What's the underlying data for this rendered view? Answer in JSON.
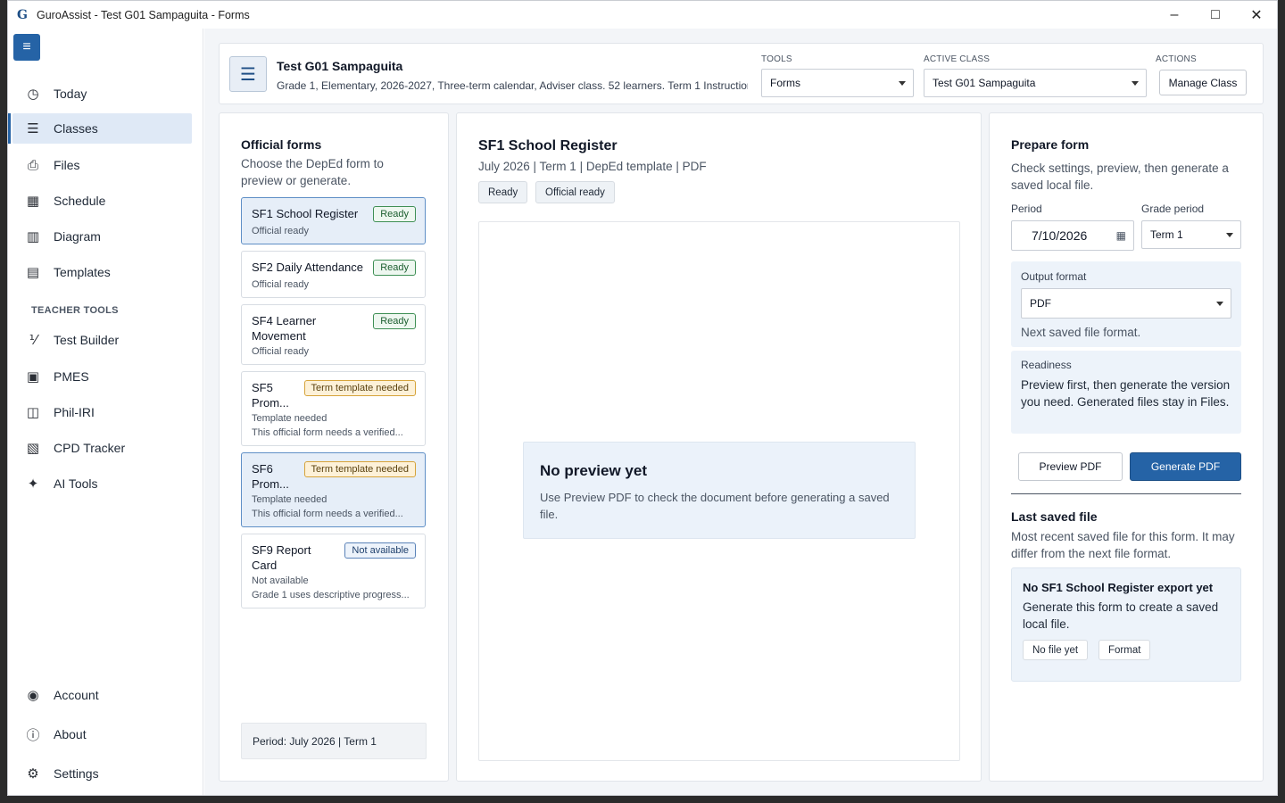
{
  "window": {
    "title": "GuroAssist - Test G01 Sampaguita - Forms",
    "app_icon": "G"
  },
  "sidebar": {
    "items": [
      {
        "label": "Today",
        "icon": "clock-icon"
      },
      {
        "label": "Classes",
        "icon": "list-icon"
      },
      {
        "label": "Files",
        "icon": "file-icon"
      },
      {
        "label": "Schedule",
        "icon": "calendar-icon"
      },
      {
        "label": "Diagram",
        "icon": "diagram-icon"
      },
      {
        "label": "Templates",
        "icon": "template-icon"
      }
    ],
    "section_label": "TEACHER TOOLS",
    "tools": [
      {
        "label": "Test Builder",
        "icon": "test-builder-icon"
      },
      {
        "label": "PMES",
        "icon": "pmes-icon"
      },
      {
        "label": "Phil-IRI",
        "icon": "book-icon"
      },
      {
        "label": "CPD Tracker",
        "icon": "tracker-icon"
      },
      {
        "label": "AI Tools",
        "icon": "magic-wand-icon"
      }
    ],
    "bottom": [
      {
        "label": "Account",
        "icon": "account-icon"
      },
      {
        "label": "About",
        "icon": "info-icon"
      },
      {
        "label": "Settings",
        "icon": "gear-icon"
      }
    ],
    "active": "Classes"
  },
  "header": {
    "class_title": "Test G01 Sampaguita",
    "class_sub": "Grade 1, Elementary, 2026-2027, Three-term calendar, Adviser class. 52 learners. Term 1 Instruction...",
    "tools_label": "TOOLS",
    "tools_value": "Forms",
    "active_class_label": "ACTIVE CLASS",
    "active_class_value": "Test G01 Sampaguita",
    "actions_label": "ACTIONS",
    "manage_class": "Manage Class"
  },
  "forms_panel": {
    "title": "Official forms",
    "desc": "Choose the DepEd form to preview or generate.",
    "forms": [
      {
        "name": "SF1 School Register",
        "badge": "Ready",
        "status": "Official ready",
        "note": ""
      },
      {
        "name": "SF2 Daily Attendance",
        "badge": "Ready",
        "status": "Official ready",
        "note": ""
      },
      {
        "name": "SF4 Learner Movement",
        "badge": "Ready",
        "status": "Official ready",
        "note": ""
      },
      {
        "name": "SF5 Prom...",
        "badge": "Term template needed",
        "status": "Template needed",
        "note": "This official form needs a verified..."
      },
      {
        "name": "SF6 Prom...",
        "badge": "Term template needed",
        "status": "Template needed",
        "note": "This official form needs a verified..."
      },
      {
        "name": "SF9 Report Card",
        "badge": "Not available",
        "status": "Not available",
        "note": "Grade 1 uses descriptive progress..."
      }
    ],
    "period": "Period: July 2026 | Term 1"
  },
  "preview": {
    "title": "SF1 School Register",
    "meta": "July 2026 | Term 1 | DepEd template | PDF",
    "chips": [
      "Ready",
      "Official ready"
    ],
    "empty_title": "No preview yet",
    "empty_desc": "Use Preview PDF to check the document before generating a saved file."
  },
  "prepare": {
    "title": "Prepare form",
    "desc": "Check settings, preview, then generate a saved local file.",
    "period_label": "Period",
    "period_value": "7/10/2026",
    "grade_period_label": "Grade period",
    "grade_period_value": "Term 1",
    "output_format_label": "Output format",
    "output_format_value": "PDF",
    "output_format_hint": "Next saved file format.",
    "readiness_label": "Readiness",
    "readiness_text": "Preview first, then generate the version you need. Generated files stay in Files.",
    "preview_btn": "Preview PDF",
    "generate_btn": "Generate PDF",
    "last_saved_title": "Last saved file",
    "last_saved_desc": "Most recent saved file for this form. It may differ from the next file format.",
    "no_export_title": "No SF1 School Register export yet",
    "no_export_desc": "Generate this form to create a saved local file.",
    "chip_no_file": "No file yet",
    "chip_format": "Format"
  },
  "colors": {
    "accent": "#2563a6",
    "ready": "#3f8f55",
    "warning": "#d6a33a",
    "selected_bg": "#e6eef8"
  }
}
